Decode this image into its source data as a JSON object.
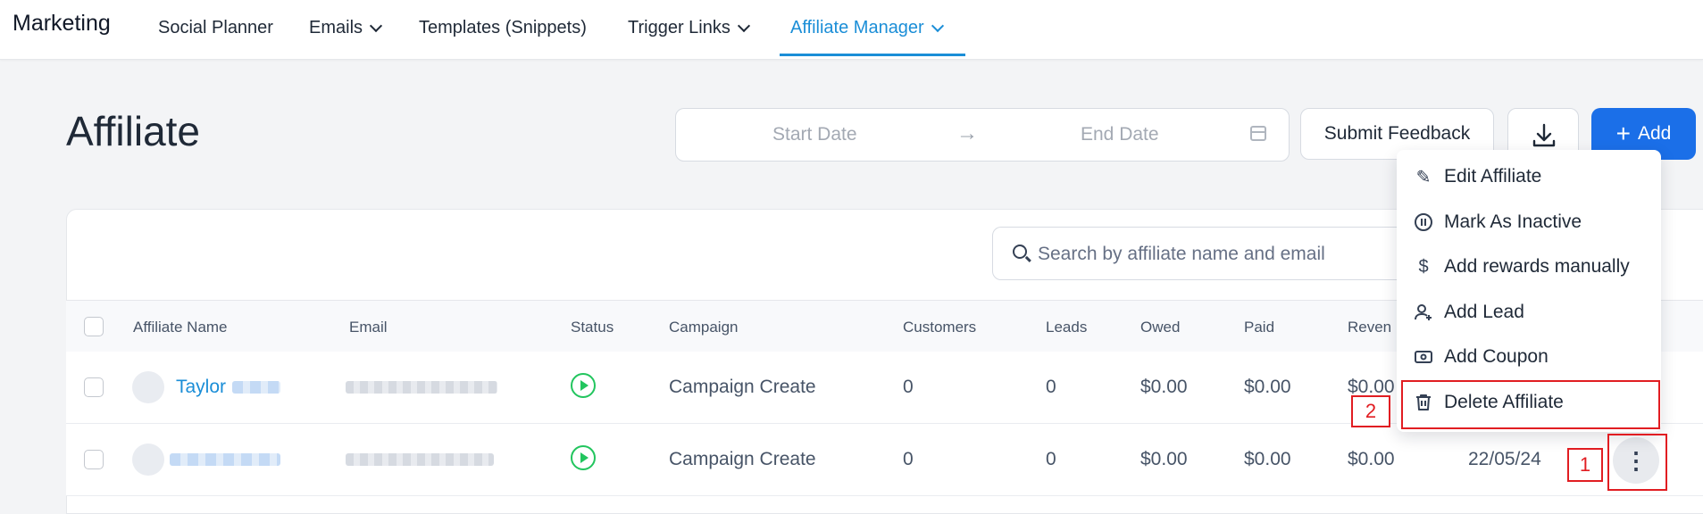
{
  "topnav": {
    "brand": "Marketing",
    "items": [
      {
        "label": "Social Planner"
      },
      {
        "label": "Emails"
      },
      {
        "label": "Templates (Snippets)"
      },
      {
        "label": "Trigger Links"
      },
      {
        "label": "Affiliate Manager",
        "active": true
      }
    ]
  },
  "page": {
    "title": "Affiliate"
  },
  "daterange": {
    "start_placeholder": "Start Date",
    "arrow": "→",
    "end_placeholder": "End Date"
  },
  "actions": {
    "feedback": "Submit Feedback",
    "add": "Add",
    "add_icon": "+"
  },
  "search": {
    "placeholder": "Search by affiliate name and email"
  },
  "table": {
    "columns": [
      "Affiliate Name",
      "Email",
      "Status",
      "Campaign",
      "Customers",
      "Leads",
      "Owed",
      "Paid",
      "Reven"
    ],
    "rows": [
      {
        "name": "Taylor",
        "campaign": "Campaign Create",
        "customers": "0",
        "leads": "0",
        "owed": "$0.00",
        "paid": "$0.00",
        "revenue": "$0.00",
        "date": ""
      },
      {
        "name": "",
        "campaign": "Campaign Create",
        "customers": "0",
        "leads": "0",
        "owed": "$0.00",
        "paid": "$0.00",
        "revenue": "$0.00",
        "date": "22/05/24"
      }
    ]
  },
  "row_menu": {
    "items": [
      {
        "label": "Edit Affiliate",
        "icon": "pencil-icon"
      },
      {
        "label": "Mark As Inactive",
        "icon": "pause-icon"
      },
      {
        "label": "Add rewards manually",
        "icon": "dollar-icon"
      },
      {
        "label": "Add Lead",
        "icon": "user-plus-icon"
      },
      {
        "label": "Add Coupon",
        "icon": "coupon-icon"
      },
      {
        "label": "Delete Affiliate",
        "icon": "trash-icon"
      }
    ]
  },
  "annotations": {
    "label1": "1",
    "label2": "2",
    "color": "#e11d22"
  },
  "colors": {
    "accent": "#1b8ed7",
    "primary_button": "#1b6fe8",
    "status_active": "#22c55e"
  }
}
